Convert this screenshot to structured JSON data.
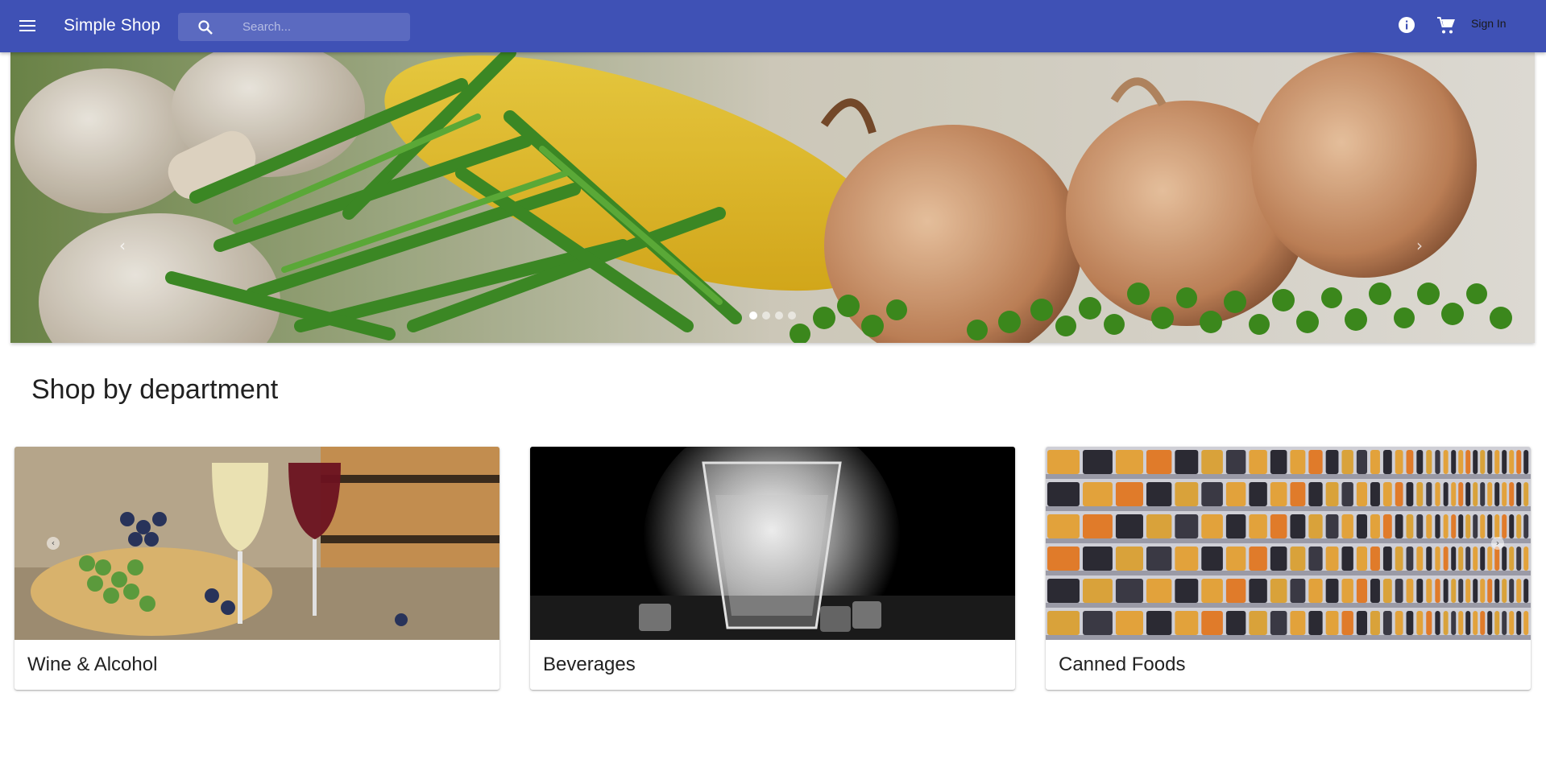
{
  "app": {
    "title": "Simple Shop",
    "search_placeholder": "Search...",
    "signin_label": "Sign In",
    "accent_color": "#3f51b5"
  },
  "hero": {
    "prev_glyph": "‹",
    "next_glyph": "›",
    "slide_count": 4,
    "active_slide": 1
  },
  "section": {
    "title": "Shop by department"
  },
  "departments": [
    {
      "label": "Wine & Alcohol"
    },
    {
      "label": "Beverages"
    },
    {
      "label": "Canned Foods"
    }
  ],
  "icons": {
    "menu": "menu-icon",
    "search": "search-icon",
    "info": "info-icon",
    "cart": "cart-icon"
  }
}
